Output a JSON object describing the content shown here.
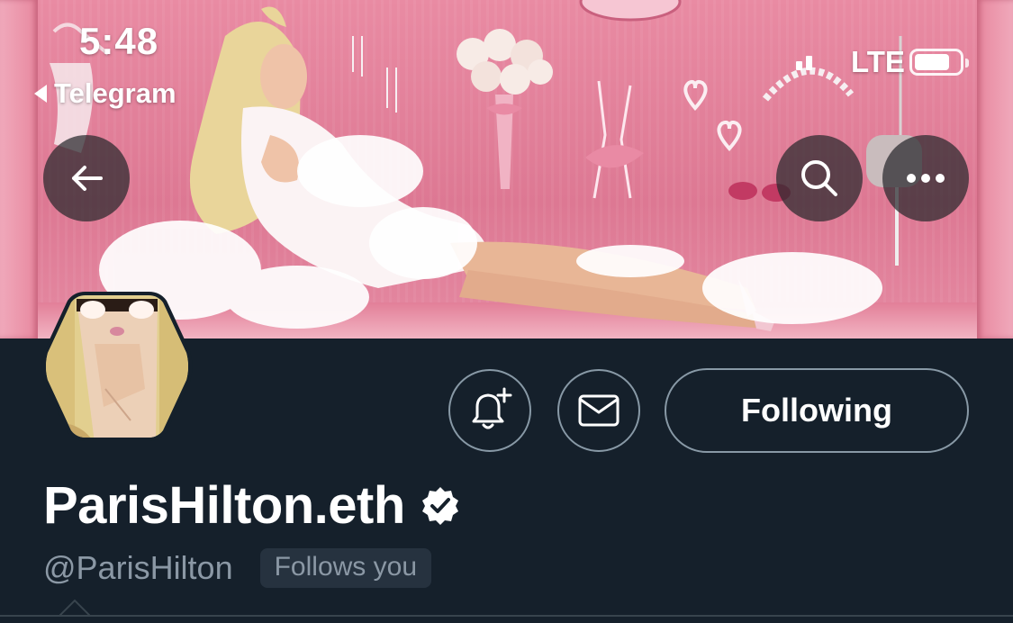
{
  "status_bar": {
    "time": "5:48",
    "back_label": "Telegram",
    "network": "LTE"
  },
  "banner": {
    "back_icon": "arrow-left-icon",
    "search_icon": "search-icon",
    "more_icon": "more-horizontal-icon"
  },
  "profile": {
    "display_name": "ParisHilton.eth",
    "handle": "@ParisHilton",
    "follows_you_label": "Follows you",
    "verified_icon": "verified-badge-icon"
  },
  "actions": {
    "notify_icon": "bell-plus-icon",
    "message_icon": "mail-icon",
    "following_label": "Following"
  },
  "colors": {
    "background": "#15202b",
    "secondary_text": "#8b98a5",
    "border": "#8899a6",
    "banner_pink": "#e27f98"
  }
}
